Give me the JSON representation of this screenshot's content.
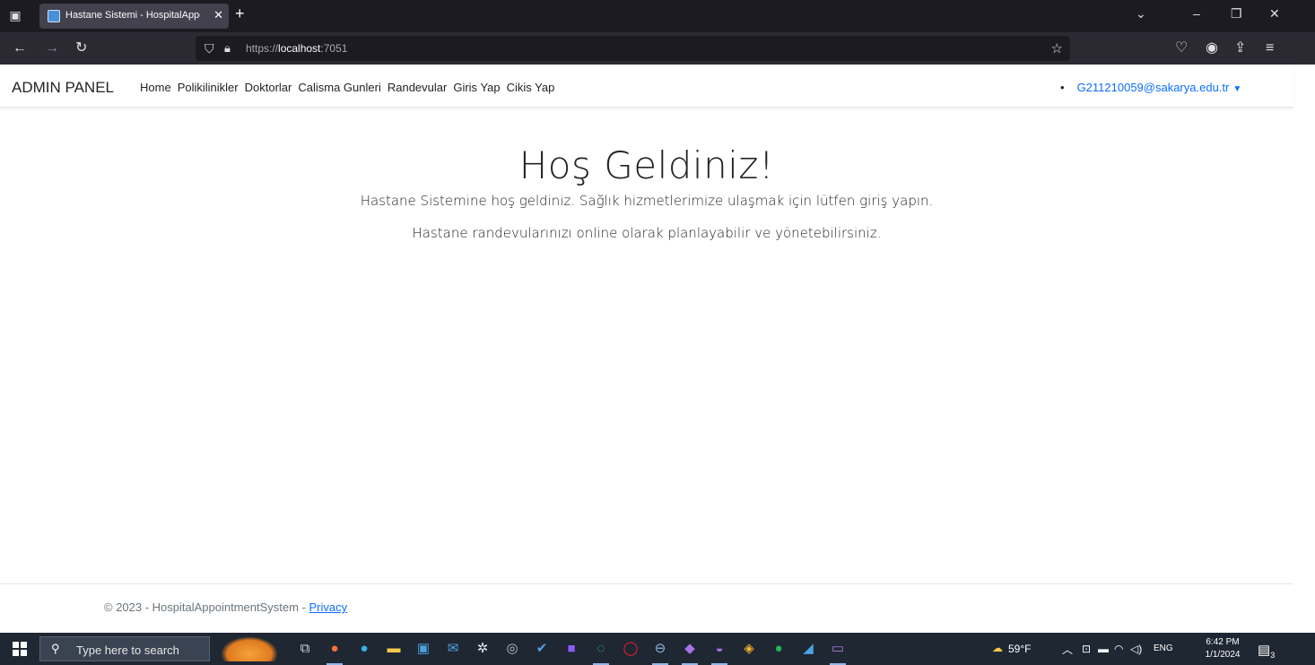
{
  "browser": {
    "tab_title": "Hastane Sistemi - HospitalAppointmentSystem",
    "url_prefix": "https://",
    "url_host": "localhost",
    "url_port": ":7051"
  },
  "site": {
    "brand": "ADMIN PANEL",
    "nav": [
      "Home",
      "Polikilinikler",
      "Doktorlar",
      "Calisma Gunleri",
      "Randevular",
      "Giris Yap",
      "Cikis Yap"
    ],
    "user_email": "G211210059@sakarya.edu.tr"
  },
  "hero": {
    "heading": "Hoş Geldiniz!",
    "line1": "Hastane Sistemine hoş geldiniz. Sağlık hizmetlerimize ulaşmak için lütfen giriş yapın.",
    "line2": "Hastane randevularınızı online olarak planlayabilir ve yönetebilirsiniz."
  },
  "footer": {
    "copyright": "© 2023 - HospitalAppointmentSystem - ",
    "privacy_link": "Privacy"
  },
  "taskbar": {
    "search_placeholder": "Type here to search",
    "weather": "59°F",
    "language": "ENG",
    "time": "6:42 PM",
    "date": "1/1/2024",
    "notification_count": "3"
  },
  "colors": {
    "link": "#0d6efd",
    "chrome_dark": "#1c1b22",
    "taskbar": "#1f2733"
  }
}
